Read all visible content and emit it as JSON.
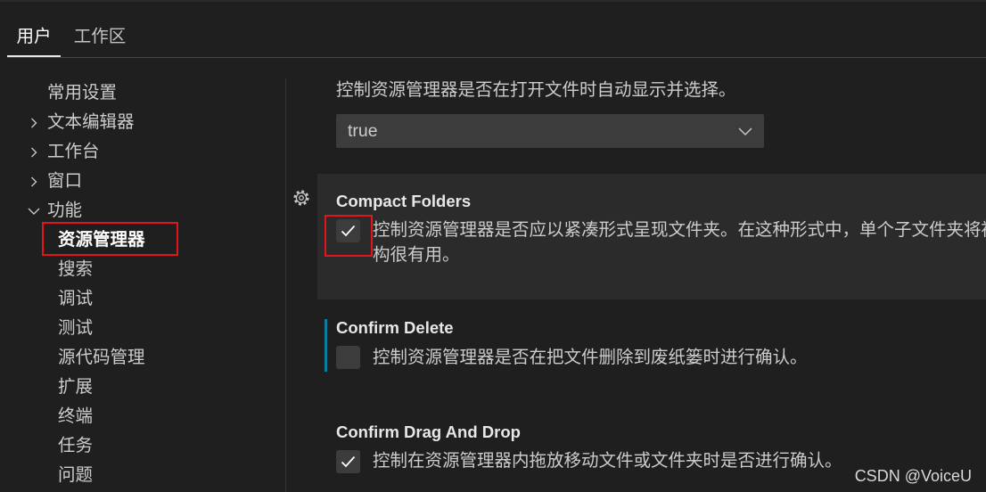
{
  "colors": {
    "background": "#1f1f1f",
    "text": "#cccccc",
    "focused_row_background": "#2b2b2c",
    "input_background": "#3c3c3c",
    "modified_indicator": "#0c7d9d",
    "annotation_red": "#e3141c"
  },
  "tabs": [
    {
      "label": "用户",
      "active": true
    },
    {
      "label": "工作区",
      "active": false
    }
  ],
  "toc": {
    "items": [
      {
        "label": "常用设置"
      },
      {
        "label": "文本编辑器",
        "icon": "chevron-right-icon",
        "expanded": false
      },
      {
        "label": "工作台",
        "icon": "chevron-right-icon",
        "expanded": false
      },
      {
        "label": "窗口",
        "icon": "chevron-right-icon",
        "expanded": false
      },
      {
        "label": "功能",
        "icon": "chevron-down-icon",
        "expanded": true,
        "children": [
          {
            "label": "资源管理器",
            "selected": true
          },
          {
            "label": "搜索"
          },
          {
            "label": "调试"
          },
          {
            "label": "测试"
          },
          {
            "label": "源代码管理"
          },
          {
            "label": "扩展"
          },
          {
            "label": "终端"
          },
          {
            "label": "任务"
          },
          {
            "label": "问题"
          }
        ]
      }
    ]
  },
  "settings": {
    "auto_reveal": {
      "description": "控制资源管理器是否在打开文件时自动显示并选择。",
      "value": "true",
      "icon": "chevron-down-icon"
    },
    "compact_folders": {
      "title": "Compact Folders",
      "checked": true,
      "focused": true,
      "menu_icon": "gear-icon",
      "description_lines": [
        "控制资源管理器是否应以紧凑形式呈现文件夹。在这种形式中，单个子文件夹将被",
        "构很有用。"
      ]
    },
    "confirm_delete": {
      "title": "Confirm Delete",
      "checked": false,
      "modified": true,
      "description": "控制资源管理器是否在把文件删除到废纸篓时进行确认。"
    },
    "confirm_drag_and_drop": {
      "title": "Confirm Drag And Drop",
      "checked": true,
      "description": "控制在资源管理器内拖放移动文件或文件夹时是否进行确认。"
    }
  },
  "watermark": "CSDN @VoiceU"
}
